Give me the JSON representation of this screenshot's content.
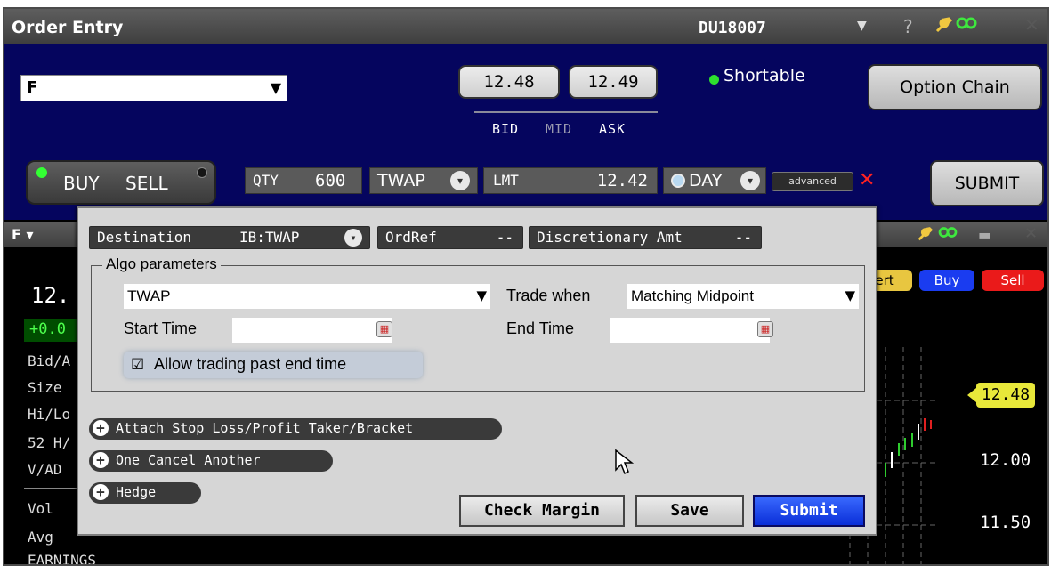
{
  "order_entry": {
    "title": "Order Entry",
    "account": "DU18007",
    "account_caret": "▼",
    "help": "?",
    "close": "✕",
    "symbol": "F",
    "bid": "12.48",
    "ask": "12.49",
    "bid_label": "BID",
    "mid_label": "MID",
    "ask_label": "ASK",
    "shortable": "Shortable",
    "option_chain": "Option Chain",
    "buy": "BUY",
    "sell": "SELL",
    "qty_label": "QTY",
    "qty_value": "600",
    "algo": "TWAP",
    "order_type": "LMT",
    "limit_price": "12.42",
    "tif": "DAY",
    "advanced": "advanced",
    "advanced_close": "✕",
    "submit": "SUBMIT"
  },
  "chart_window": {
    "symbol": "F ▾",
    "close": "✕",
    "last_price": "12.",
    "change": "+0.0",
    "side_labels": [
      "Bid/A",
      "Size",
      "Hi/Lo",
      "52 H/",
      "V/AD",
      "Vol",
      "Avg",
      "EARNINGS"
    ],
    "alert_button": "ert",
    "buy_button": "Buy",
    "sell_button": "Sell",
    "axis_price_highlight": "12.48",
    "axis_labels": [
      "12.00",
      "11.50"
    ]
  },
  "advanced_panel": {
    "destination_label": "Destination",
    "destination_value": "IB:TWAP",
    "ordref_label": "OrdRef",
    "ordref_value": "--",
    "discretionary_label": "Discretionary Amt",
    "discretionary_value": "--",
    "algo_legend": "Algo parameters",
    "algo_select": "TWAP",
    "trade_when_label": "Trade when",
    "trade_when_value": "Matching Midpoint",
    "start_time_label": "Start Time",
    "start_time_value": "",
    "end_time_label": "End Time",
    "end_time_value": "",
    "allow_checkbox": "☑",
    "allow_label": "Allow trading past end time",
    "attach_label": "Attach Stop Loss/Profit Taker/Bracket",
    "oca_label": "One Cancel Another",
    "hedge_label": "Hedge",
    "check_margin": "Check Margin",
    "save": "Save",
    "submit": "Submit"
  },
  "icons": {
    "dropdown_caret": "▼",
    "circle_caret": "▾",
    "plus": "+",
    "calendar": "▦",
    "wrench": "🔧",
    "link": "∞",
    "minimize": "▬"
  },
  "colors": {
    "order_panel_bg": "#05055e",
    "shortable_dot": "#2ee02e",
    "buy_active": "#33ff33",
    "submit_blue": "#1a3cf0",
    "sell_red": "#ea1a1a",
    "price_highlight": "#e8e83a"
  }
}
